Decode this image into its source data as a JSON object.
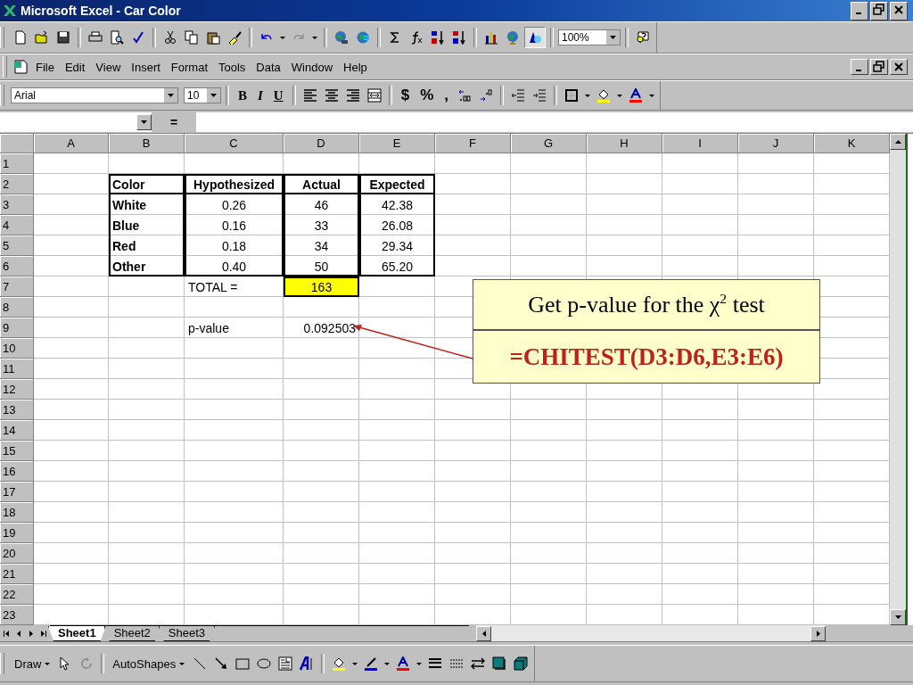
{
  "window": {
    "title": "Microsoft Excel - Car  Color"
  },
  "standard_toolbar": {
    "zoom": "100%"
  },
  "menu": [
    {
      "label": "File"
    },
    {
      "label": "Edit"
    },
    {
      "label": "View"
    },
    {
      "label": "Insert"
    },
    {
      "label": "Format"
    },
    {
      "label": "Tools"
    },
    {
      "label": "Data"
    },
    {
      "label": "Window"
    },
    {
      "label": "Help"
    }
  ],
  "formatting_toolbar": {
    "font": "Arial",
    "size": "10",
    "bold": "B",
    "italic": "I",
    "underline": "U",
    "currency": "$",
    "percent": "%",
    "comma": ","
  },
  "formula_bar": {
    "equals": "="
  },
  "sheet": {
    "columns": [
      "A",
      "B",
      "C",
      "D",
      "E",
      "F",
      "G",
      "H",
      "I",
      "J",
      "K"
    ],
    "rows": [
      "1",
      "2",
      "3",
      "4",
      "5",
      "6",
      "7",
      "8",
      "9",
      "10",
      "11",
      "12",
      "13",
      "14",
      "15",
      "16",
      "17",
      "18",
      "19",
      "20",
      "21",
      "22",
      "23"
    ],
    "table": {
      "columns": [
        "Color",
        "Hypothesized",
        "Actual",
        "Expected"
      ],
      "rows": [
        [
          "White",
          "0.26",
          "46",
          "42.38"
        ],
        [
          "Blue",
          "0.16",
          "33",
          "26.08"
        ],
        [
          "Red",
          "0.18",
          "34",
          "29.34"
        ],
        [
          "Other",
          "0.40",
          "50",
          "65.20"
        ]
      ]
    },
    "total": {
      "label": "TOTAL =",
      "value": "163",
      "highlighted": true
    },
    "p_value": {
      "label": "p-value",
      "value": "0.092503"
    }
  },
  "callout": {
    "title": "Get p-value for the χ$^{2}$ test",
    "formula": "=CHITEST(D3:D6,E3:E6)"
  },
  "sheet_tabs": [
    {
      "label": "Sheet1",
      "selected": true
    },
    {
      "label": "Sheet2",
      "selected": false
    },
    {
      "label": "Sheet3",
      "selected": false
    }
  ],
  "drawing_toolbar": {
    "draw": "Draw",
    "autoshapes": "AutoShapes"
  }
}
